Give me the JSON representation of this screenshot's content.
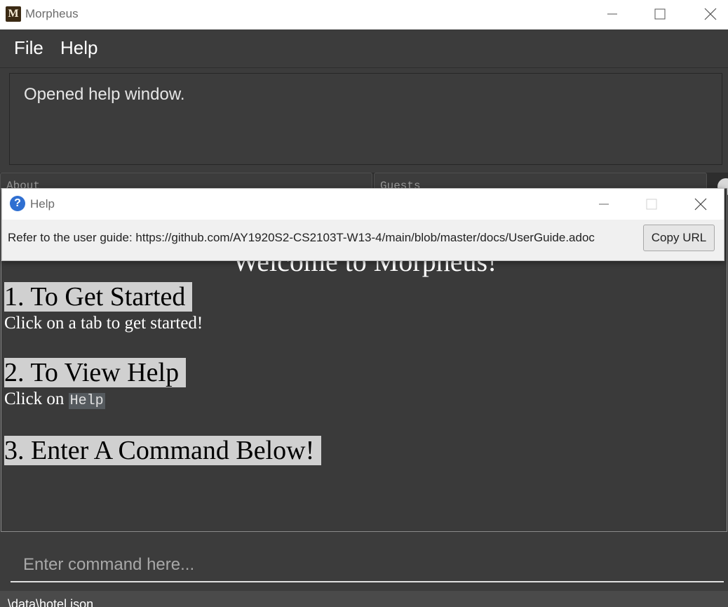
{
  "window": {
    "title": "Morpheus",
    "icon_letter": "M"
  },
  "menu": {
    "items": [
      {
        "label": "File"
      },
      {
        "label": "Help"
      }
    ]
  },
  "result_display": {
    "text": "Opened help window."
  },
  "tabs": [
    {
      "label": "About"
    },
    {
      "label": "Guests"
    }
  ],
  "content": {
    "welcome": "Welcome to Morpheus!",
    "sections": [
      {
        "heading": "1. To Get Started",
        "text": "Click on a tab to get started!"
      },
      {
        "heading": "2. To View Help",
        "text_prefix": "Click on ",
        "code": "Help"
      },
      {
        "heading": "3. Enter A Command Below!"
      }
    ]
  },
  "command": {
    "placeholder": "Enter command here...",
    "value": ""
  },
  "status": {
    "path": ".\\data\\hotel.json"
  },
  "help_dialog": {
    "title": "Help",
    "icon_glyph": "?",
    "message": "Refer to the user guide: https://github.com/AY1920S2-CS2103T-W13-4/main/blob/master/docs/UserGuide.adoc",
    "copy_button": "Copy URL"
  },
  "colors": {
    "background": "#3c3c3c",
    "heading_highlight": "#d0d0d0",
    "help_icon": "#2f6fd1"
  }
}
